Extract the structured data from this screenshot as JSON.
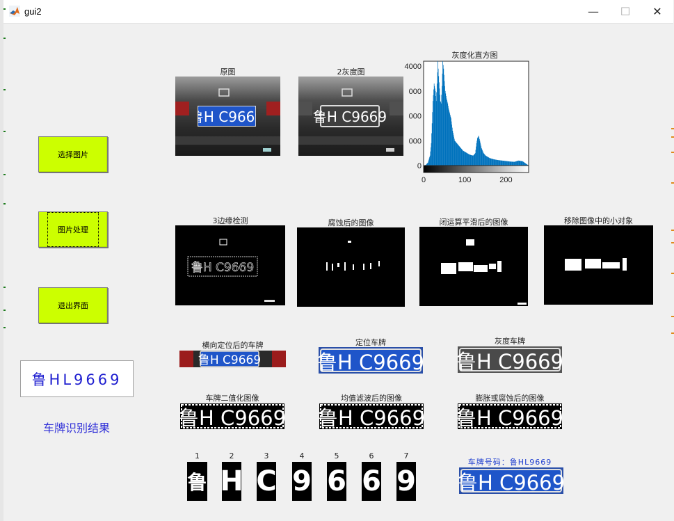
{
  "window": {
    "title": "gui2",
    "minimize_glyph": "—",
    "maximize_glyph": "☐",
    "close_glyph": "✕"
  },
  "buttons": {
    "select_image": "选择图片",
    "process_image": "图片处理",
    "exit": "退出界面"
  },
  "result": {
    "plate_text": "鲁HL9669",
    "label": "车牌识别结果"
  },
  "plate_chars": [
    "鲁",
    "H",
    "C",
    "9",
    "6",
    "6",
    "9"
  ],
  "panels": {
    "original": "原图",
    "gray": "2灰度图",
    "histogram": "灰度化直方图",
    "edge": "3边缘检测",
    "eroded": "腐蚀后的图像",
    "closed": "闭运算平滑后的图像",
    "removed": "移除图像中的小对象",
    "h_located": "横向定位后的车牌",
    "located": "定位车牌",
    "gray_plate": "灰度车牌",
    "binary": "车牌二值化图像",
    "mean_filter": "均值滤波后的图像",
    "dilate": "膨胀或腐蚀后的图像",
    "plate_number": "车牌号码：鲁HL9669",
    "seg_labels": [
      "1",
      "2",
      "3",
      "4",
      "5",
      "6",
      "7"
    ]
  },
  "chart_data": {
    "type": "area",
    "title": "灰度化直方图",
    "xlabel": "",
    "ylabel": "",
    "xlim": [
      0,
      255
    ],
    "ylim": [
      0,
      4200
    ],
    "xticks": [
      0,
      100,
      200
    ],
    "yticks": [
      0,
      1000,
      2000,
      3000,
      4000
    ],
    "ytick_labels": [
      "0",
      "000",
      "000",
      "000",
      "4000"
    ],
    "color": "#0072bd",
    "x": [
      0,
      5,
      10,
      15,
      18,
      20,
      22,
      25,
      28,
      30,
      32,
      34,
      36,
      38,
      40,
      42,
      44,
      46,
      48,
      50,
      52,
      55,
      58,
      60,
      63,
      66,
      70,
      75,
      80,
      85,
      90,
      95,
      100,
      105,
      110,
      115,
      120,
      125,
      128,
      130,
      133,
      136,
      140,
      145,
      150,
      160,
      170,
      180,
      190,
      200,
      210,
      220,
      230,
      240,
      250,
      255
    ],
    "values": [
      0,
      30,
      120,
      400,
      900,
      1700,
      2600,
      3300,
      3000,
      2600,
      3300,
      4200,
      3600,
      3100,
      2600,
      2500,
      3200,
      4200,
      3900,
      3400,
      3000,
      2700,
      2500,
      2300,
      2100,
      1900,
      1400,
      1000,
      900,
      800,
      700,
      600,
      550,
      500,
      450,
      420,
      400,
      500,
      900,
      1100,
      1200,
      1000,
      700,
      500,
      400,
      300,
      250,
      220,
      200,
      180,
      160,
      150,
      200,
      170,
      50,
      0
    ]
  }
}
